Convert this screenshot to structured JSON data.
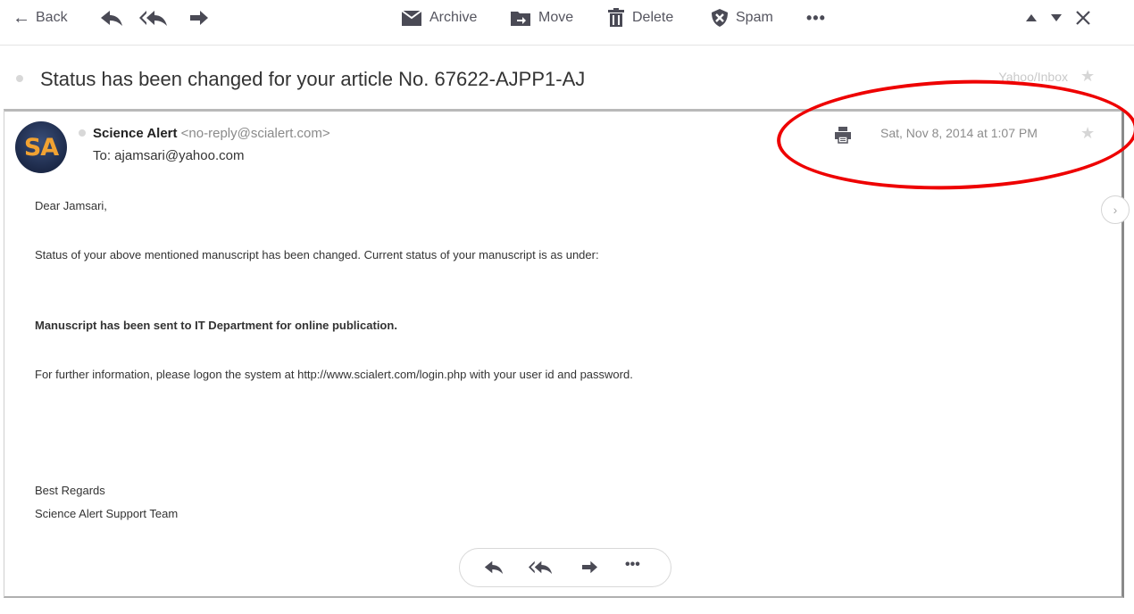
{
  "toolbar": {
    "back_label": "Back",
    "archive_label": "Archive",
    "move_label": "Move",
    "delete_label": "Delete",
    "spam_label": "Spam",
    "more_label": "•••"
  },
  "message": {
    "subject": "Status has been changed for your article No. 67622-AJPP1-AJ",
    "folder": "Yahoo/Inbox",
    "sender_name": "Science Alert",
    "sender_email": "<no-reply@scialert.com>",
    "to": "To: ajamsari@yahoo.com",
    "date": "Sat, Nov 8, 2014 at 1:07 PM",
    "avatar_initials": "SA",
    "greeting": "Dear Jamsari,",
    "paragraph1": "Status of your above mentioned manuscript has been changed. Current status of your manuscript is as under:",
    "status_line": "Manuscript has been sent to IT Department for online publication.",
    "paragraph2": "For further information, please logon the system at http://www.scialert.com/login.php with your user id and password.",
    "closing": "Best Regards",
    "signature": "Science Alert Support Team"
  },
  "footer_actions": {
    "more_label": "•••"
  },
  "colors": {
    "annotation_circle": "#ee0000",
    "avatar_bg": "#1c2948",
    "avatar_text": "#f1a232"
  }
}
